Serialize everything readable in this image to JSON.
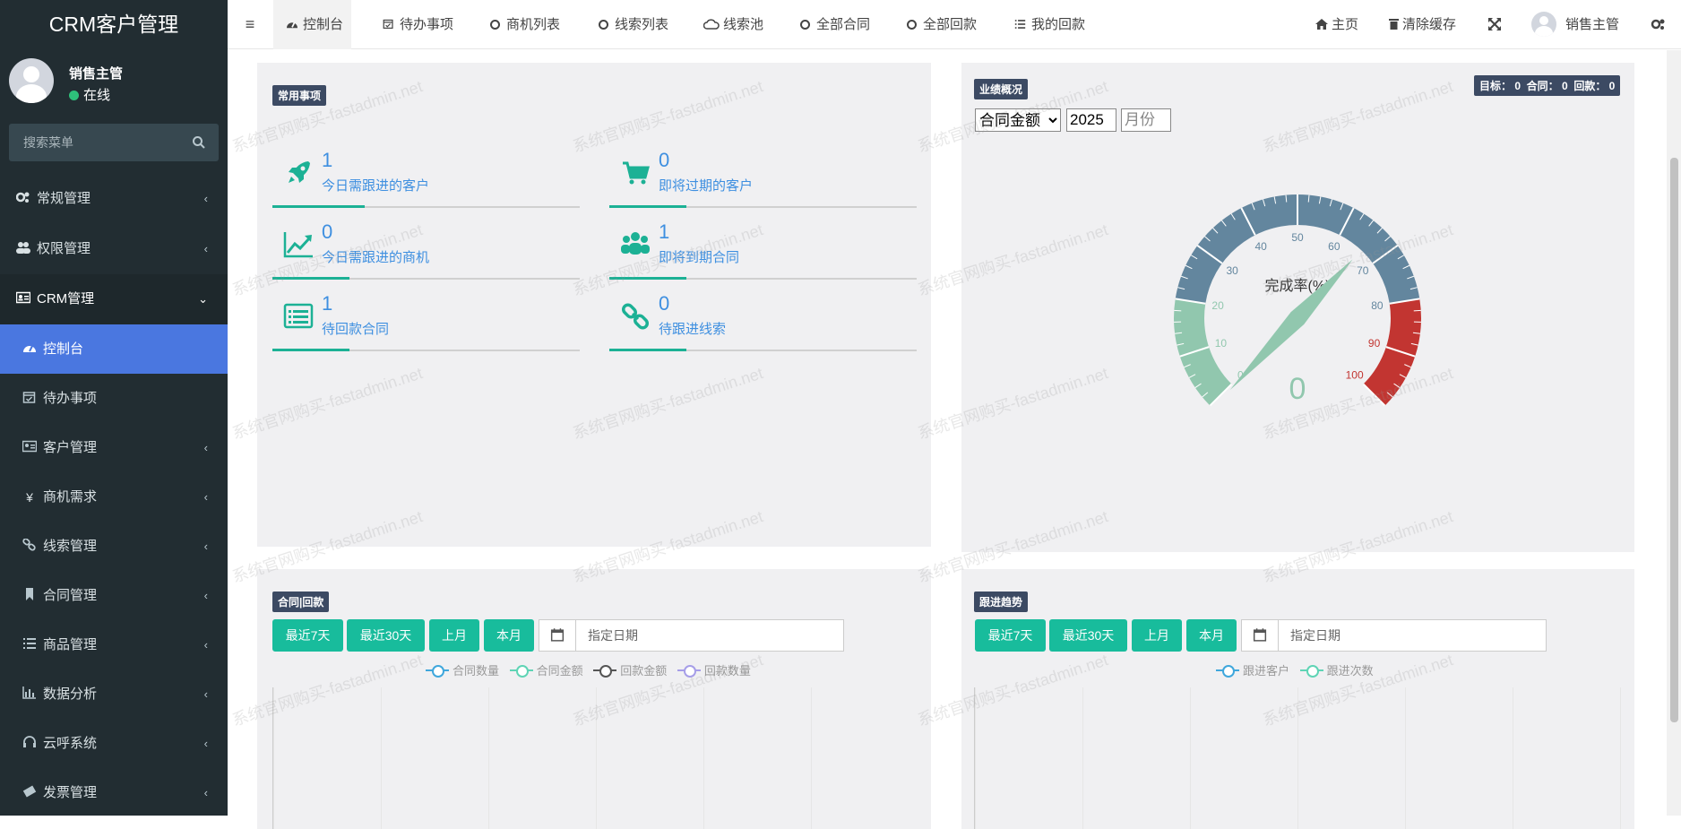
{
  "app": {
    "title": "CRM客户管理"
  },
  "user": {
    "name": "销售主管",
    "status": "在线"
  },
  "sidebar": {
    "search_placeholder": "搜索菜单",
    "items": [
      {
        "label": "常规管理",
        "icon": "gears-icon",
        "arrow": "‹"
      },
      {
        "label": "权限管理",
        "icon": "group-icon",
        "arrow": "‹"
      },
      {
        "label": "CRM管理",
        "icon": "id-card-icon",
        "arrow": "⌄"
      },
      {
        "label": "控制台",
        "icon": "dashboard-icon"
      },
      {
        "label": "待办事项",
        "icon": "calendar-check-icon"
      },
      {
        "label": "客户管理",
        "icon": "id-card-icon",
        "arrow": "‹"
      },
      {
        "label": "商机需求",
        "icon": "yen-icon",
        "arrow": "‹"
      },
      {
        "label": "线索管理",
        "icon": "chain-icon",
        "arrow": "‹"
      },
      {
        "label": "合同管理",
        "icon": "bookmark-icon",
        "arrow": "‹"
      },
      {
        "label": "商品管理",
        "icon": "list-icon",
        "arrow": "‹"
      },
      {
        "label": "数据分析",
        "icon": "bar-chart-icon",
        "arrow": "‹"
      },
      {
        "label": "云呼系统",
        "icon": "headphones-icon",
        "arrow": "‹"
      },
      {
        "label": "发票管理",
        "icon": "ticket-icon",
        "arrow": "‹"
      }
    ]
  },
  "topbar": {
    "tabs": [
      "控制台",
      "待办事项",
      "商机列表",
      "线索列表",
      "线索池",
      "全部合同",
      "全部回款",
      "我的回款"
    ],
    "home": "主页",
    "clear_cache": "清除缓存",
    "user": "销售主管"
  },
  "common": {
    "badge": "常用事项",
    "stats": [
      {
        "num": "1",
        "label": "今日需跟进的客户",
        "icon": "rocket-icon",
        "progress": 0.3
      },
      {
        "num": "0",
        "label": "即将过期的客户",
        "icon": "cart-icon",
        "progress": 0.25
      },
      {
        "num": "0",
        "label": "今日需跟进的商机",
        "icon": "line-chart-icon",
        "progress": 0.25
      },
      {
        "num": "1",
        "label": "即将到期合同",
        "icon": "users-icon",
        "progress": 0.25
      },
      {
        "num": "1",
        "label": "待回款合同",
        "icon": "list-alt-icon",
        "progress": 0.25
      },
      {
        "num": "0",
        "label": "待跟进线索",
        "icon": "chain-icon",
        "progress": 0.25
      }
    ]
  },
  "performance": {
    "badge": "业绩概况",
    "summary": "目标： 0  合同： 0  回款： 0",
    "select_value": "合同金额",
    "year": "2025",
    "month_placeholder": "月份",
    "gauge_title": "完成率(%)",
    "gauge_value": "0",
    "ticks": [
      "0",
      "10",
      "20",
      "30",
      "40",
      "50",
      "60",
      "70",
      "80",
      "90",
      "100"
    ],
    "colors": {
      "low": "#91c7ae",
      "mid": "#63869e",
      "high": "#c23531"
    }
  },
  "contract": {
    "badge": "合同|回款",
    "buttons": [
      "最近7天",
      "最近30天",
      "上月",
      "本月"
    ],
    "date_placeholder": "指定日期",
    "legend": [
      "合同数量",
      "合同金额",
      "回款金额",
      "回款数量"
    ]
  },
  "followup": {
    "badge": "跟进趋势",
    "buttons": [
      "最近7天",
      "最近30天",
      "上月",
      "本月"
    ],
    "date_placeholder": "指定日期",
    "legend": [
      "跟进客户",
      "跟进次数"
    ]
  },
  "watermark": "系统官网购买-fastadmin.net"
}
